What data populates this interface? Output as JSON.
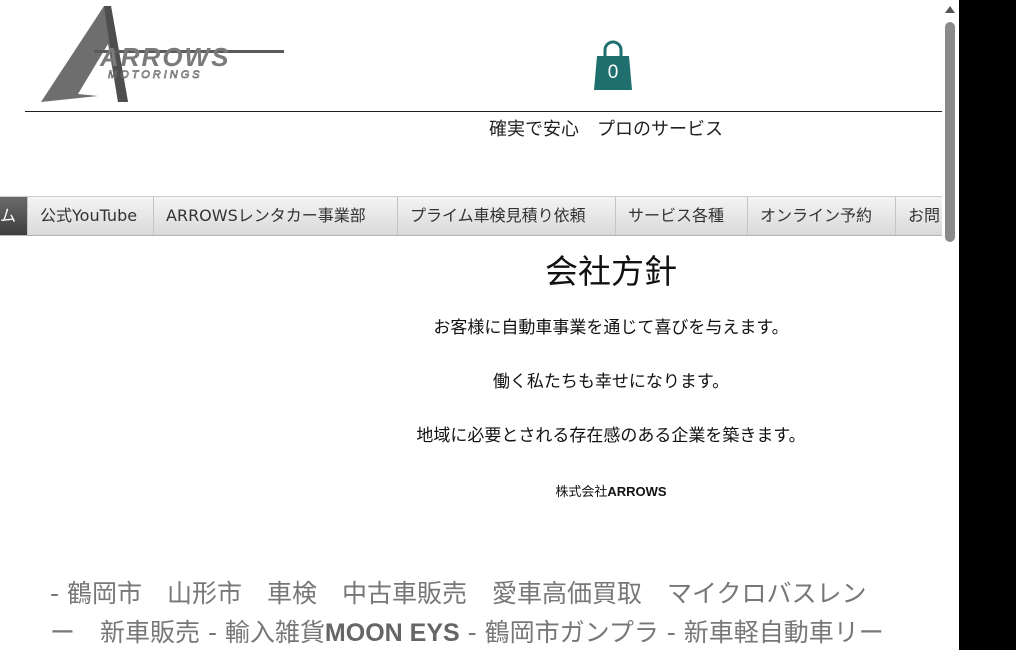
{
  "header": {
    "logo_main": "ARROWS",
    "logo_sub": "MOTORINGS",
    "cart_count": "0",
    "tagline": "確実で安心　プロのサービス"
  },
  "nav": {
    "items": [
      {
        "label": "ム",
        "active": true
      },
      {
        "label": "公式YouTube"
      },
      {
        "label": "ARROWSレンタカー事業部"
      },
      {
        "label": "プライム車検見積り依頼"
      },
      {
        "label": "サービス各種"
      },
      {
        "label": "オンライン予約"
      },
      {
        "label": "お問"
      }
    ]
  },
  "policy": {
    "title": "会社方針",
    "lines": [
      "お客様に自動車事業を通じて喜びを与えます。",
      "働く私たちも幸せになります。",
      "地域に必要とされる存在感のある企業を築きます。"
    ],
    "company_prefix": "株式会社",
    "company_bold": "ARROWS"
  },
  "keywords": {
    "line1": "- 鶴岡市　山形市　車検　中古車販売　愛車高価買取　マイクロバスレン",
    "line2_a": "ー　新車販売 - 輸入雑貨",
    "line2_b": "MOON EYS",
    "line2_c": " - 鶴岡市ガンプラ - 新車軽自動車リー"
  },
  "colors": {
    "cart": "#1f6f6f",
    "nav_active": "#4a4a4a",
    "logo_gray": "#6b6b6b"
  }
}
